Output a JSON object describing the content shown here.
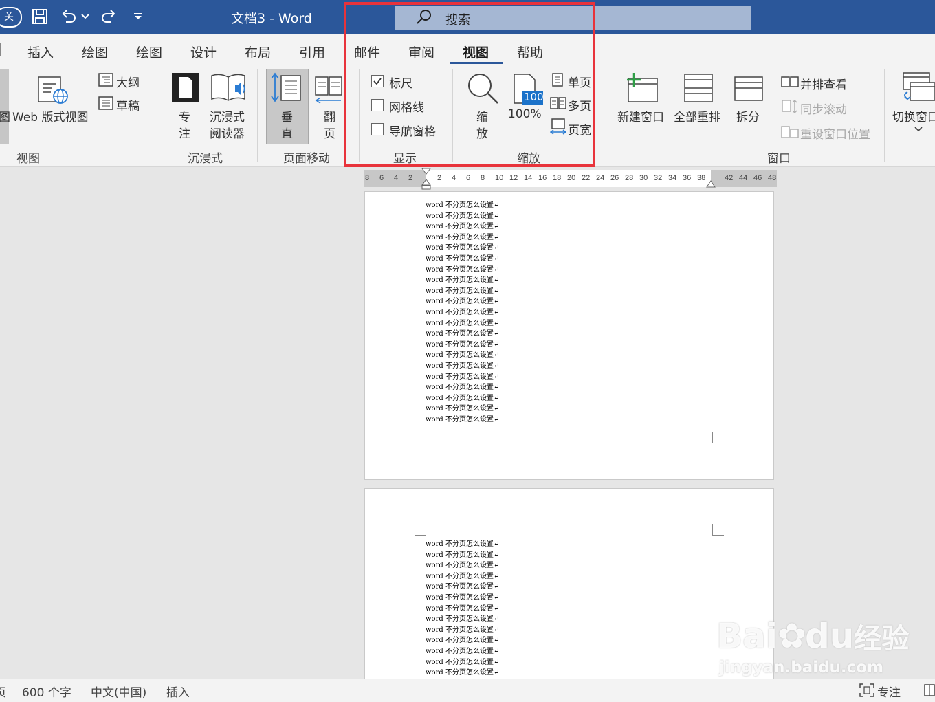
{
  "titlebar": {
    "doc_title": "文档3  -  Word",
    "close_partial": "关",
    "search_label": "搜索"
  },
  "tabs": [
    {
      "label": "插入"
    },
    {
      "label": "绘图"
    },
    {
      "label": "绘图"
    },
    {
      "label": "设计"
    },
    {
      "label": "布局"
    },
    {
      "label": "引用"
    },
    {
      "label": "邮件"
    },
    {
      "label": "审阅"
    },
    {
      "label": "视图",
      "active": true
    },
    {
      "label": "帮助"
    }
  ],
  "ribbon": {
    "views": {
      "left_partial": "图",
      "web": "Web 版式视图",
      "outline": "大纲",
      "draft": "草稿",
      "group": "视图"
    },
    "immersive": {
      "focus_1": "专",
      "focus_2": "注",
      "reader_1": "沉浸式",
      "reader_2": "阅读器",
      "group": "沉浸式"
    },
    "pagemove": {
      "vertical_1": "垂",
      "vertical_2": "直",
      "side_1": "翻",
      "side_2": "页",
      "group": "页面移动"
    },
    "show": {
      "ruler": "标尺",
      "ruler_checked": true,
      "gridlines": "网格线",
      "navpane": "导航窗格",
      "group": "显示"
    },
    "zoom": {
      "zoom_1": "缩",
      "zoom_2": "放",
      "pct_badge": "100",
      "pct": "100%",
      "one_page": "单页",
      "multi_page": "多页",
      "page_width": "页宽",
      "group": "缩放"
    },
    "window": {
      "new": "新建窗口",
      "arrange": "全部重排",
      "split": "拆分",
      "side_by_side": "并排查看",
      "sync_scroll": "同步滚动",
      "reset_pos": "重设窗口位置",
      "switch": "切换窗口",
      "group": "窗口"
    }
  },
  "ruler": {
    "left_nums": [
      "8",
      "6",
      "4",
      "2"
    ],
    "mid_nums": [
      "2",
      "4",
      "6",
      "8",
      "10",
      "12",
      "14",
      "16",
      "18",
      "20",
      "22",
      "24",
      "26",
      "28",
      "30",
      "32",
      "34",
      "36",
      "38"
    ],
    "right_nums": [
      "42",
      "44",
      "46",
      "48"
    ]
  },
  "document": {
    "line_text": "word 不分页怎么设置",
    "page1_lines": 21,
    "page2_lines": 13
  },
  "status": {
    "page_partial": "页",
    "word_count": "600 个字",
    "language": "中文(中国)",
    "mode": "插入",
    "focus": "专注"
  },
  "watermark": {
    "brand": "Bai",
    "brand2": "du",
    "cn": "经验",
    "url": "jingyan.baidu.com"
  },
  "colors": {
    "title_blue": "#2b579a",
    "highlight_red": "#e8333b",
    "ribbon_bg": "#f3f3f3",
    "canvas_gray": "#e6e6e6"
  }
}
